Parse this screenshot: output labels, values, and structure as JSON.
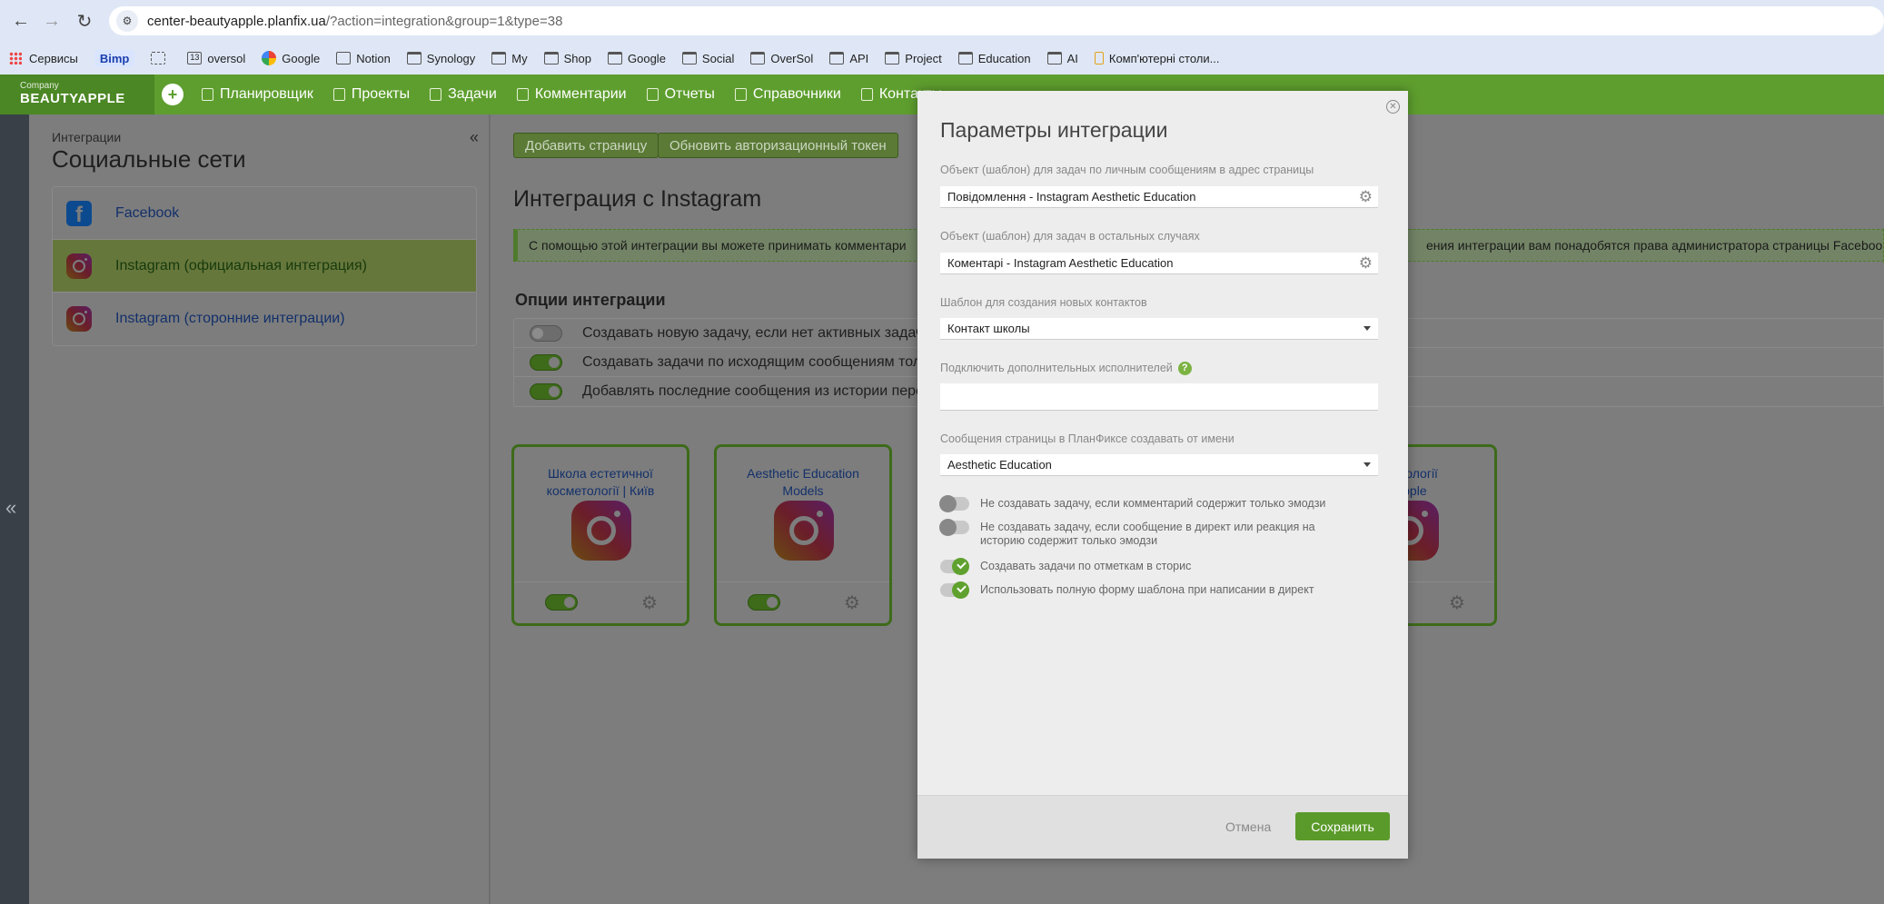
{
  "browser": {
    "url_host": "center-beautyapple.planfix.ua",
    "url_path": "/?action=integration&group=1&type=38",
    "bookmarks": [
      "Сервисы",
      "Bimp",
      "oversol",
      "Google",
      "Notion",
      "Synology",
      "My",
      "Shop",
      "Google",
      "Social",
      "OverSol",
      "API",
      "Project",
      "Education",
      "AI",
      "Комп'ютерні столи..."
    ],
    "bookmark_badge": "13"
  },
  "app": {
    "company_label": "Company",
    "company_name": "BEAUTYAPPLE",
    "nav": [
      "Планировщик",
      "Проекты",
      "Задачи",
      "Комментарии",
      "Отчеты",
      "Справочники",
      "Контакты"
    ]
  },
  "sidebar": {
    "breadcrumb": "Интеграции",
    "title": "Социальные сети",
    "items": [
      {
        "label": "Facebook",
        "icon": "facebook-icon"
      },
      {
        "label": "Instagram (официальная интеграция)",
        "icon": "instagram-icon"
      },
      {
        "label": "Instagram (сторонние интеграции)",
        "icon": "instagram-icon"
      }
    ]
  },
  "main": {
    "add_page_label": "Добавить страницу",
    "refresh_token_label": "Обновить авторизационный токен",
    "title": "Интеграция с Instagram",
    "info_left": "С помощью этой интеграции вы можете принимать комментари",
    "info_right": "ения интеграции вам понадобятся права администратора страницы Facebook, а к",
    "options_title": "Опции интеграции",
    "options": [
      {
        "label": "Создавать новую задачу, если нет активных задач об",
        "on": false
      },
      {
        "label": "Создавать задачи по исходящим сообщениям только",
        "on": true
      },
      {
        "label": "Добавлять последние сообщения из истории перепи",
        "on": true
      }
    ],
    "cards": [
      {
        "line1": "Школа естетичної",
        "line2": "косметології | Київ"
      },
      {
        "line1": "Aesthetic Education",
        "line2": "Models"
      },
      {
        "line1": "сметології",
        "line2": "yapple"
      }
    ]
  },
  "modal": {
    "title": "Параметры интеграции",
    "f1_label": "Объект (шаблон) для задач по личным сообщениям в адрес страницы",
    "f1_value": "Повідомлення - Instagram Aesthetic Education",
    "f2_label": "Объект (шаблон) для задач в остальных случаях",
    "f2_value": "Коментарі - Instagram Aesthetic Education",
    "f3_label": "Шаблон для создания новых контактов",
    "f3_value": "Контакт школы",
    "f4_label": "Подключить дополнительных исполнителей",
    "f4_help": "?",
    "f5_label": "Сообщения страницы в ПланФиксе создавать от имени",
    "f5_value": "Aesthetic Education",
    "toggles": [
      {
        "label": "Не создавать задачу, если комментарий содержит только эмодзи",
        "on": false
      },
      {
        "label": "Не создавать задачу, если сообщение в директ или реакция на историю содержит только эмодзи",
        "on": false
      },
      {
        "label": "Создавать задачи по отметкам в сторис",
        "on": true
      },
      {
        "label": "Использовать полную форму шаблона при написании в директ",
        "on": true
      }
    ],
    "cancel_label": "Отмена",
    "save_label": "Сохранить"
  },
  "colors": {
    "accent": "#5e9e2e",
    "save": "#5a9a2a"
  }
}
